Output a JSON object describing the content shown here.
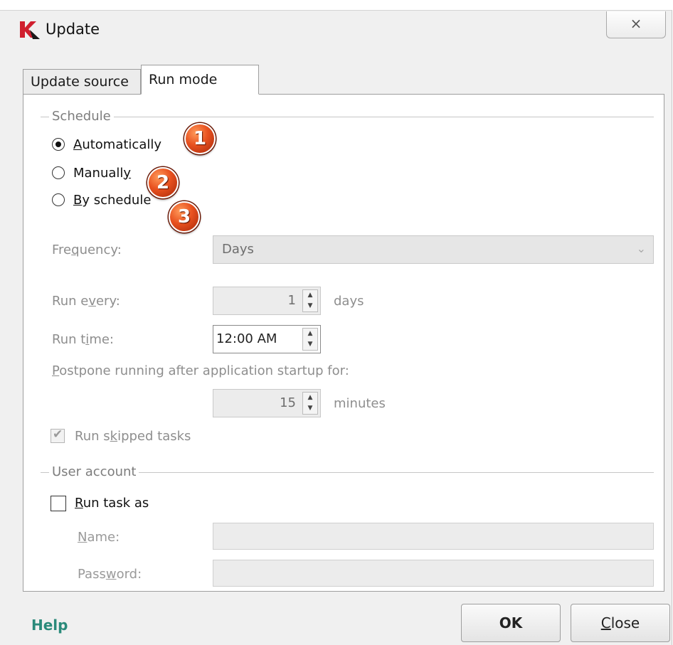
{
  "window": {
    "title": "Update",
    "close_glyph": "×",
    "logo_icon": "kaspersky-k-icon",
    "accent_color": "#d01f2e"
  },
  "tabs": [
    {
      "label": "Update source",
      "active": false
    },
    {
      "label": "Run mode",
      "active": true
    }
  ],
  "schedule": {
    "group_label": "Schedule",
    "options": [
      {
        "label": "Automatically",
        "checked": true,
        "badge": "1"
      },
      {
        "label": "Manually",
        "checked": false,
        "badge": "2"
      },
      {
        "label": "By schedule",
        "checked": false,
        "badge": "3"
      }
    ],
    "frequency": {
      "label": "Frequency:",
      "value": "Days"
    },
    "run_every": {
      "label": "Run every:",
      "value": "1",
      "unit": "days"
    },
    "run_time": {
      "label": "Run time:",
      "value": "12:00 AM"
    },
    "postpone": {
      "label": "Postpone running after application startup for:",
      "value": "15",
      "unit": "minutes"
    },
    "run_skipped": {
      "label": "Run skipped tasks",
      "checked": true
    }
  },
  "user_account": {
    "group_label": "User account",
    "run_task_as": {
      "label": "Run task as",
      "checked": false
    },
    "name": {
      "label": "Name:",
      "value": ""
    },
    "password": {
      "label": "Password:",
      "value": ""
    }
  },
  "footer": {
    "help": "Help",
    "ok": "OK",
    "close": "Close",
    "help_color": "#2a8a7a"
  }
}
